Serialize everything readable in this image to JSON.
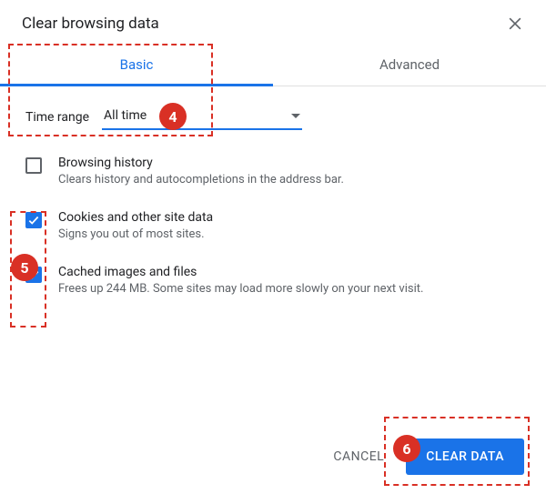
{
  "header": {
    "title": "Clear browsing data"
  },
  "tabs": {
    "basic": "Basic",
    "advanced": "Advanced"
  },
  "time_range": {
    "label": "Time range",
    "value": "All time"
  },
  "options": {
    "history": {
      "title": "Browsing history",
      "desc": "Clears history and autocompletions in the address bar."
    },
    "cookies": {
      "title": "Cookies and other site data",
      "desc": "Signs you out of most sites."
    },
    "cache": {
      "title": "Cached images and files",
      "desc": "Frees up 244 MB. Some sites may load more slowly on your next visit."
    }
  },
  "footer": {
    "cancel": "CANCEL",
    "clear": "CLEAR DATA"
  },
  "annotations": {
    "step4": "4",
    "step5": "5",
    "step6": "6"
  }
}
